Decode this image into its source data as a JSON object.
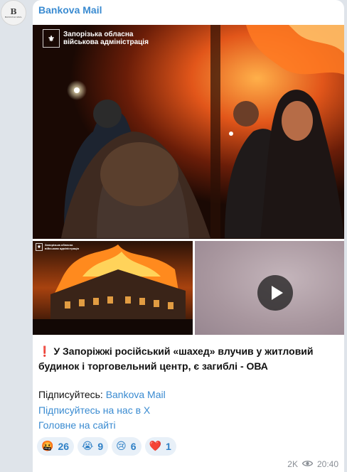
{
  "avatar": {
    "monogram": "B",
    "caption": "BANKOVA MAIL"
  },
  "channel": {
    "name": "Bankova Mail"
  },
  "media": {
    "watermark_line1": "Запорізька обласна",
    "watermark_line2": "військова адміністрація"
  },
  "post": {
    "alert_icon": "❗",
    "headline": "У Запоріжжі російський «шахед» влучив у житловий будинок і торговельний центр, є загиблі - ОВА",
    "subscribe_prefix": "Підписуйтесь:",
    "subscribe_link": "Bankova Mail",
    "x_link": "Підписуйтесь на нас в Х",
    "site_link": "Головне на сайті"
  },
  "reactions": [
    {
      "emoji": "🤬",
      "count": "26"
    },
    {
      "emoji": "😭",
      "count": "9"
    },
    {
      "emoji": "😢",
      "count": "6"
    },
    {
      "emoji": "❤️",
      "count": "1"
    }
  ],
  "meta": {
    "views": "2K",
    "time": "20:40"
  }
}
